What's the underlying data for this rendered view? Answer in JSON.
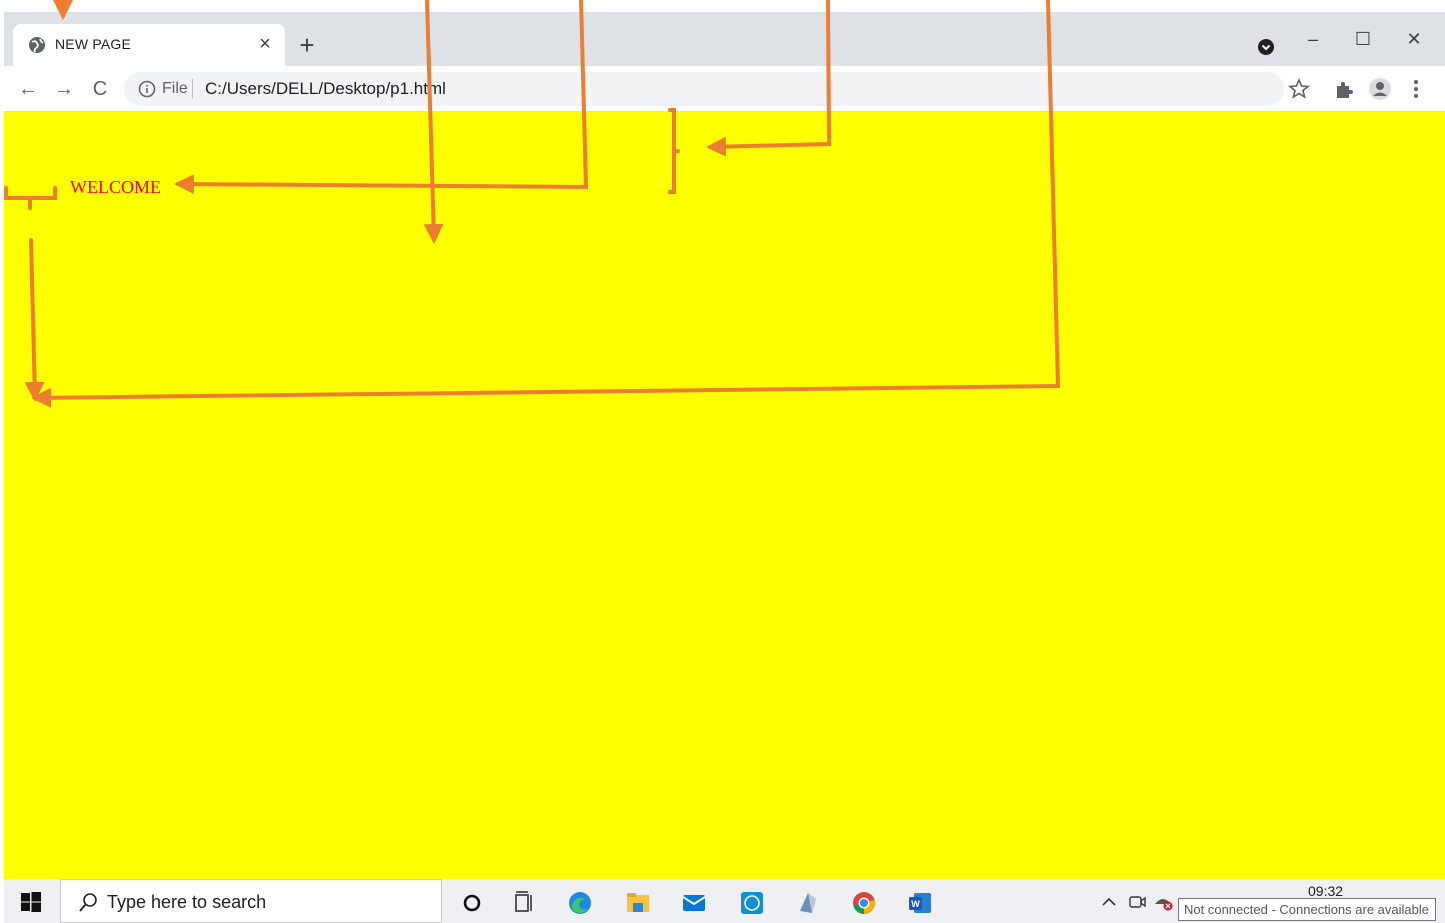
{
  "browser": {
    "tab": {
      "title": "NEW PAGE",
      "close_glyph": "×"
    },
    "new_tab_glyph": "+",
    "window_controls": {
      "minimize": "–",
      "maximize": "☐",
      "close": "✕"
    },
    "nav": {
      "back": "←",
      "forward": "→",
      "reload": "C"
    },
    "omnibox": {
      "scheme": "File",
      "url": "C:/Users/DELL/Desktop/p1.html"
    },
    "toolbar_icons": [
      "star-icon",
      "extensions-icon",
      "profile-icon",
      "menu-icon"
    ]
  },
  "page": {
    "background_color": "#ffff00",
    "welcome_text": "WELCOME",
    "welcome_color": "#ff0000",
    "annotation_color": "#ed7d31"
  },
  "taskbar": {
    "search_placeholder": "Type here to search",
    "apps": [
      "cortana-icon",
      "task-view-icon",
      "edge-icon",
      "file-explorer-icon",
      "mail-icon",
      "dell-icon",
      "app-icon",
      "chrome-icon",
      "word-icon"
    ],
    "tray_icons": [
      "chevron-up-icon",
      "meet-now-icon",
      "network-icon"
    ],
    "clock_time": "09:32",
    "network_tooltip": "Not connected - Connections are available"
  }
}
